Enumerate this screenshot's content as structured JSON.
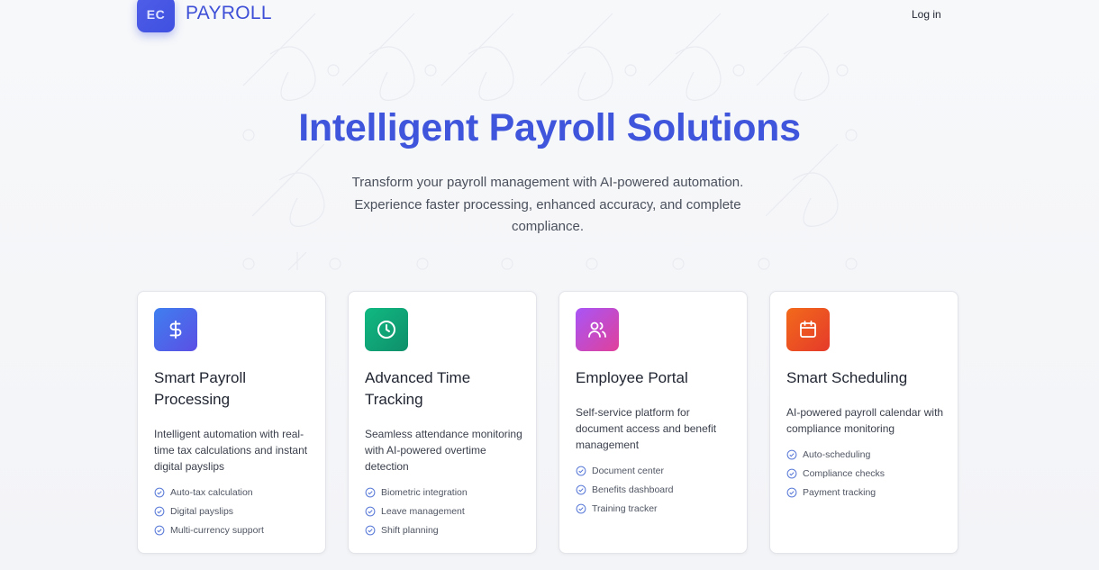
{
  "header": {
    "logo_badge": "EC",
    "logo_text": "PAYROLL",
    "login_label": "Log in"
  },
  "hero": {
    "title": "Intelligent Payroll Solutions",
    "subtitle": "Transform your payroll management with AI-powered automation. Experience faster processing, enhanced accuracy, and complete compliance."
  },
  "cards": [
    {
      "icon": "dollar-icon",
      "title": "Smart Payroll Processing",
      "description": "Intelligent automation with real-time tax calculations and instant digital payslips",
      "features": [
        "Auto-tax calculation",
        "Digital payslips",
        "Multi-currency support"
      ]
    },
    {
      "icon": "clock-icon",
      "title": "Advanced Time Tracking",
      "description": "Seamless attendance monitoring with AI-powered overtime detection",
      "features": [
        "Biometric integration",
        "Leave management",
        "Shift planning"
      ]
    },
    {
      "icon": "users-icon",
      "title": "Employee Portal",
      "description": "Self-service platform for document access and benefit management",
      "features": [
        "Document center",
        "Benefits dashboard",
        "Training tracker"
      ]
    },
    {
      "icon": "calendar-icon",
      "title": "Smart Scheduling",
      "description": "AI-powered payroll calendar with compliance monitoring",
      "features": [
        "Auto-scheduling",
        "Compliance checks",
        "Payment tracking"
      ]
    }
  ],
  "colors": {
    "brand": "#3f55dc",
    "icon_payroll": "#4a5ae6",
    "icon_time": "#12a27a",
    "icon_portal": "#c94ec8",
    "icon_schedule": "#ea4a1e",
    "check": "#5b7bd8"
  }
}
